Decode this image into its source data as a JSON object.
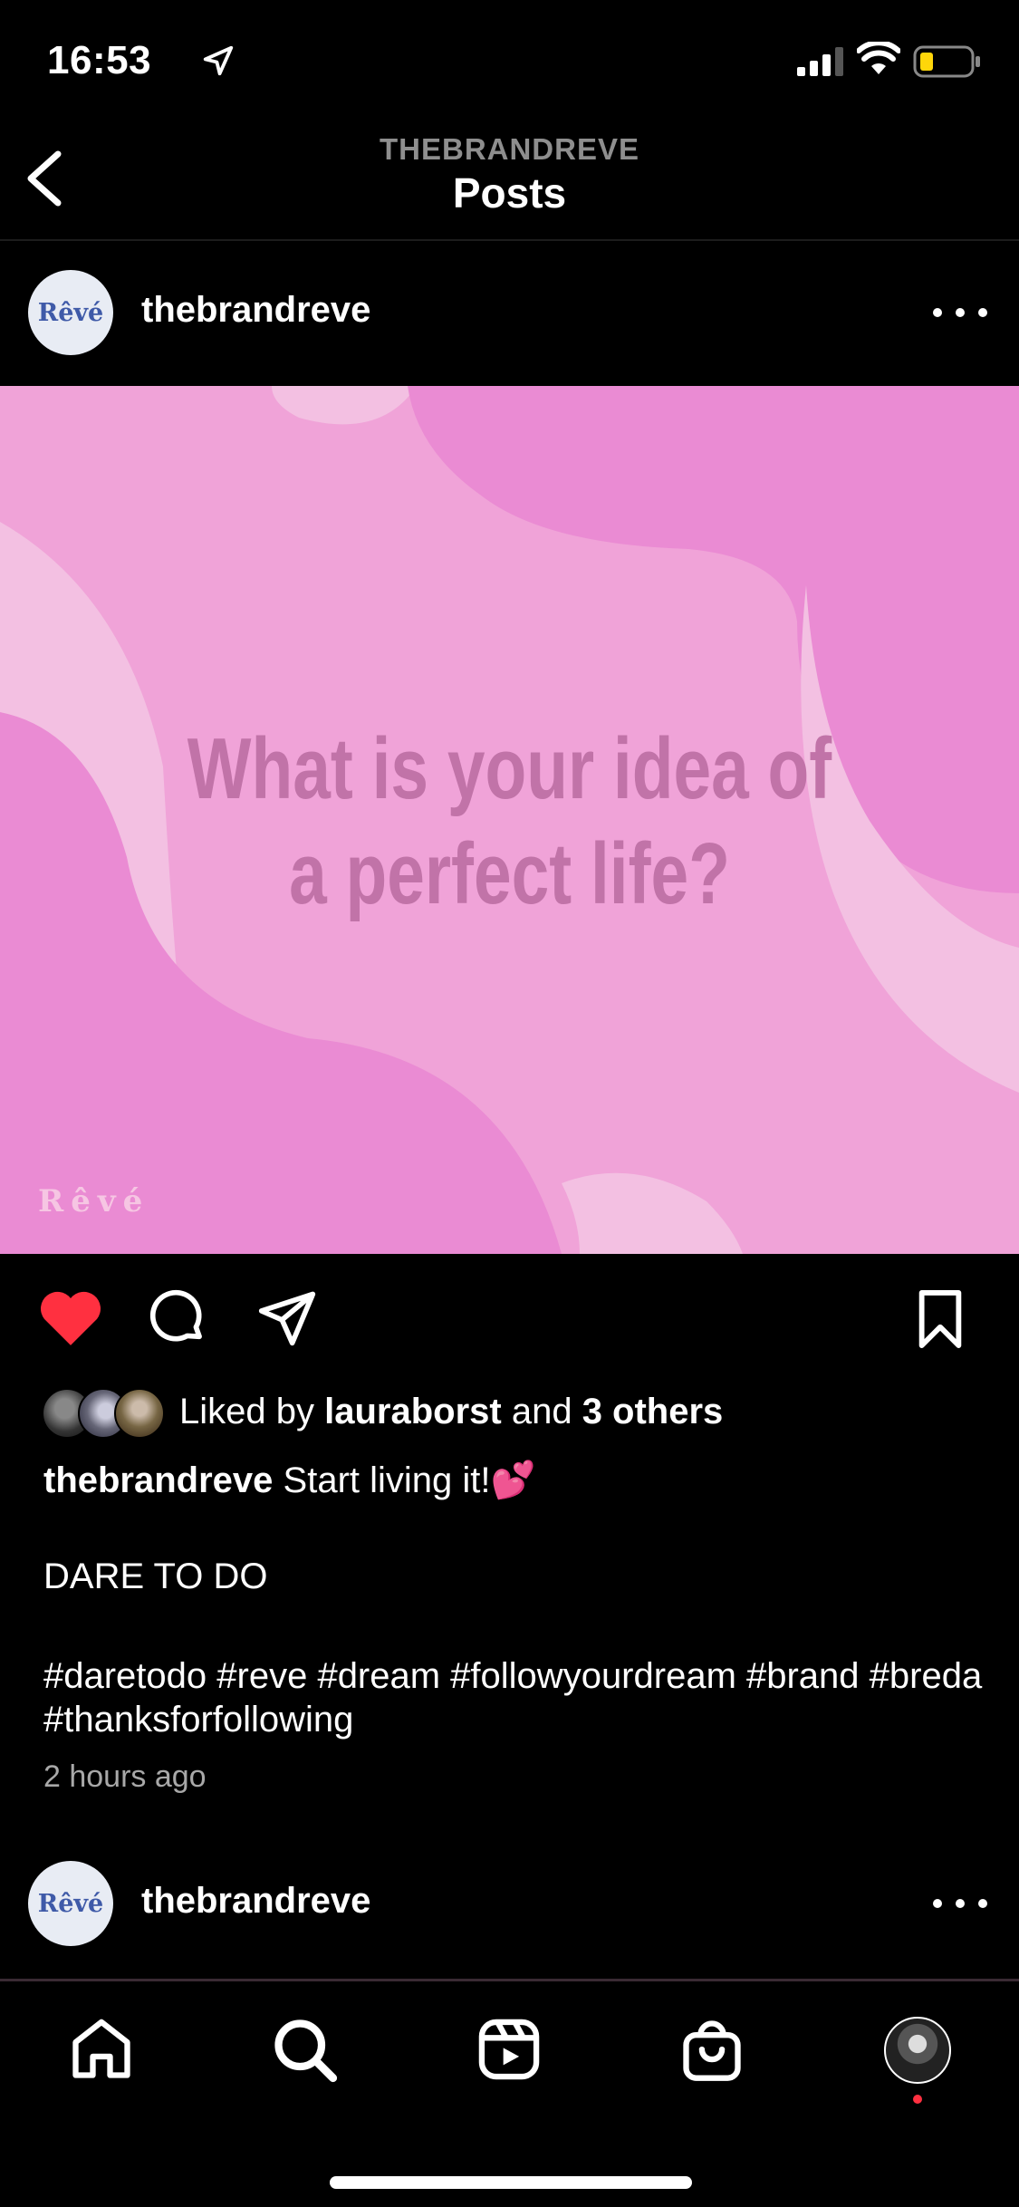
{
  "status_bar": {
    "time": "16:53"
  },
  "header": {
    "account": "THEBRANDREVE",
    "title": "Posts"
  },
  "post": {
    "avatar_text": "Rêvé",
    "username": "thebrandreve",
    "image_text_line1": "What is your idea of",
    "image_text_line2": "a perfect life?",
    "image_watermark": "Rêvé",
    "liked_by_prefix": "Liked by ",
    "liked_by_user": "lauraborst",
    "liked_by_mid": " and ",
    "liked_by_others": "3 others",
    "caption_user": "thebrandreve",
    "caption_text": " Start living it!💕",
    "caption_line2": "DARE TO DO",
    "hashtags": "#daretodo #reve #dream #followyourdream #brand #breda #thanksforfollowing",
    "time_ago": "2 hours ago"
  },
  "next_post": {
    "avatar_text": "Rêvé",
    "username": "thebrandreve"
  },
  "icons": {
    "back": "chevron-left-icon",
    "more": "more-horizontal-icon",
    "like": "heart-icon",
    "comment": "comment-icon",
    "share": "send-icon",
    "save": "bookmark-icon",
    "nav": [
      "home-icon",
      "search-icon",
      "reels-icon",
      "shop-icon",
      "profile-icon"
    ]
  },
  "colors": {
    "like_red": "#ff3040",
    "image_pink": "#f2a2d8"
  }
}
